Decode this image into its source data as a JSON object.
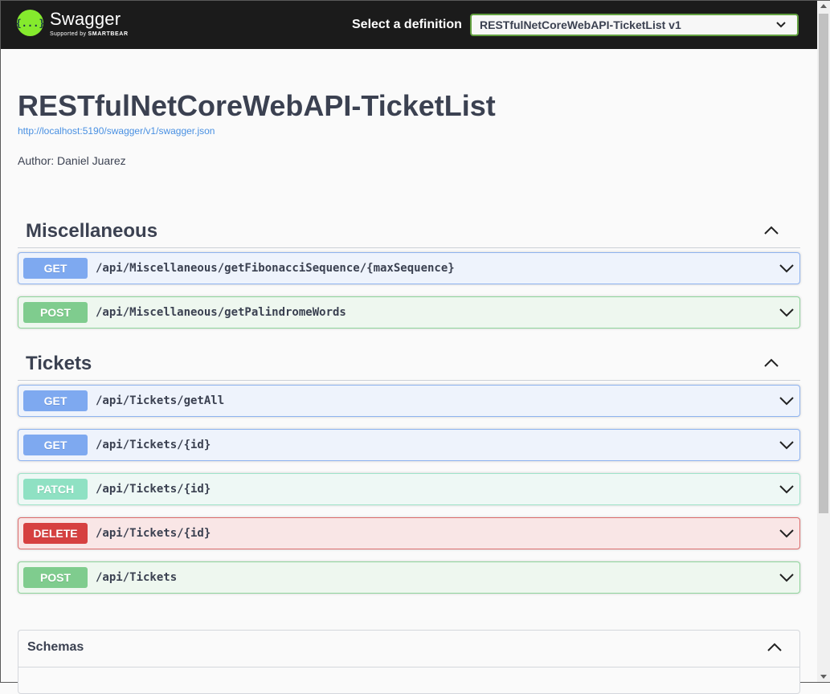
{
  "topbar": {
    "logo_name": "Swagger",
    "logo_sub_prefix": "Supported by",
    "logo_sub_brand": "SMARTBEAR",
    "logo_glyph": "{...}",
    "definition_label": "Select a definition",
    "definition_selected": "RESTfulNetCoreWebAPI-TicketList v1"
  },
  "info": {
    "title": "RESTfulNetCoreWebAPI-TicketList",
    "url": "http://localhost:5190/swagger/v1/swagger.json",
    "author": "Author: Daniel Juarez"
  },
  "sections": [
    {
      "name": "Miscellaneous",
      "operations": [
        {
          "method": "GET",
          "path": "/api/Miscellaneous/getFibonacciSequence/{maxSequence}"
        },
        {
          "method": "POST",
          "path": "/api/Miscellaneous/getPalindromeWords"
        }
      ]
    },
    {
      "name": "Tickets",
      "operations": [
        {
          "method": "GET",
          "path": "/api/Tickets/getAll"
        },
        {
          "method": "GET",
          "path": "/api/Tickets/{id}"
        },
        {
          "method": "PATCH",
          "path": "/api/Tickets/{id}"
        },
        {
          "method": "DELETE",
          "path": "/api/Tickets/{id}"
        },
        {
          "method": "POST",
          "path": "/api/Tickets"
        }
      ]
    }
  ],
  "schemas": {
    "label": "Schemas"
  },
  "colors": {
    "get": "#7ea9f0",
    "post": "#7fcc8e",
    "patch": "#8fe1c3",
    "delete": "#d64040",
    "topbar": "#1b1b1b",
    "logo": "#85ea2d"
  }
}
